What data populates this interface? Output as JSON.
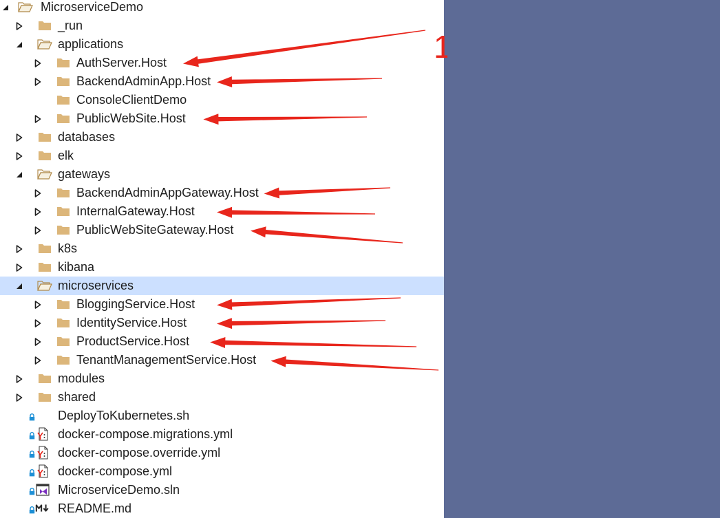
{
  "colors": {
    "panel_bg": "#5d6b96",
    "selection": "#cce0ff",
    "folder": "#dcb67a",
    "arrow": "#e8261c",
    "lock": "#1e90d6",
    "vs_purple": "#7b2fbf"
  },
  "annotation_label": "1",
  "tree": [
    {
      "label": "MicroserviceDemo",
      "depth": 0,
      "state": "expanded",
      "icon": "folder-open-icon"
    },
    {
      "label": "_run",
      "depth": 1,
      "state": "collapsed",
      "icon": "folder-icon"
    },
    {
      "label": "applications",
      "depth": 1,
      "state": "expanded",
      "icon": "folder-open-icon"
    },
    {
      "label": "AuthServer.Host",
      "depth": 2,
      "state": "collapsed",
      "icon": "folder-icon",
      "arrow": true
    },
    {
      "label": "BackendAdminApp.Host",
      "depth": 2,
      "state": "collapsed",
      "icon": "folder-icon",
      "arrow": true
    },
    {
      "label": "ConsoleClientDemo",
      "depth": 2,
      "state": "none",
      "icon": "folder-icon"
    },
    {
      "label": "PublicWebSite.Host",
      "depth": 2,
      "state": "collapsed",
      "icon": "folder-icon",
      "arrow": true
    },
    {
      "label": "databases",
      "depth": 1,
      "state": "collapsed",
      "icon": "folder-icon"
    },
    {
      "label": "elk",
      "depth": 1,
      "state": "collapsed",
      "icon": "folder-icon"
    },
    {
      "label": "gateways",
      "depth": 1,
      "state": "expanded",
      "icon": "folder-open-icon"
    },
    {
      "label": "BackendAdminAppGateway.Host",
      "depth": 2,
      "state": "collapsed",
      "icon": "folder-icon",
      "arrow": true
    },
    {
      "label": "InternalGateway.Host",
      "depth": 2,
      "state": "collapsed",
      "icon": "folder-icon",
      "arrow": true
    },
    {
      "label": "PublicWebSiteGateway.Host",
      "depth": 2,
      "state": "collapsed",
      "icon": "folder-icon",
      "arrow": true
    },
    {
      "label": "k8s",
      "depth": 1,
      "state": "collapsed",
      "icon": "folder-icon"
    },
    {
      "label": "kibana",
      "depth": 1,
      "state": "collapsed",
      "icon": "folder-icon"
    },
    {
      "label": "microservices",
      "depth": 1,
      "state": "expanded",
      "icon": "folder-open-icon",
      "selected": true
    },
    {
      "label": "BloggingService.Host",
      "depth": 2,
      "state": "collapsed",
      "icon": "folder-icon",
      "arrow": true
    },
    {
      "label": "IdentityService.Host",
      "depth": 2,
      "state": "collapsed",
      "icon": "folder-icon",
      "arrow": true
    },
    {
      "label": "ProductService.Host",
      "depth": 2,
      "state": "collapsed",
      "icon": "folder-icon",
      "arrow": true
    },
    {
      "label": "TenantManagementService.Host",
      "depth": 2,
      "state": "collapsed",
      "icon": "folder-icon",
      "arrow": true
    },
    {
      "label": "modules",
      "depth": 1,
      "state": "collapsed",
      "icon": "folder-icon"
    },
    {
      "label": "shared",
      "depth": 1,
      "state": "collapsed",
      "icon": "folder-icon"
    },
    {
      "label": "DeployToKubernetes.sh",
      "depth": 1,
      "state": "none",
      "icon": "shell-file-icon",
      "locked": true
    },
    {
      "label": "docker-compose.migrations.yml",
      "depth": 1,
      "state": "none",
      "icon": "yaml-file-icon",
      "locked": true
    },
    {
      "label": "docker-compose.override.yml",
      "depth": 1,
      "state": "none",
      "icon": "yaml-file-icon",
      "locked": true
    },
    {
      "label": "docker-compose.yml",
      "depth": 1,
      "state": "none",
      "icon": "yaml-file-icon",
      "locked": true
    },
    {
      "label": "MicroserviceDemo.sln",
      "depth": 1,
      "state": "none",
      "icon": "solution-file-icon",
      "locked": true
    },
    {
      "label": "README.md",
      "depth": 1,
      "state": "none",
      "icon": "markdown-file-icon",
      "locked": true
    }
  ]
}
